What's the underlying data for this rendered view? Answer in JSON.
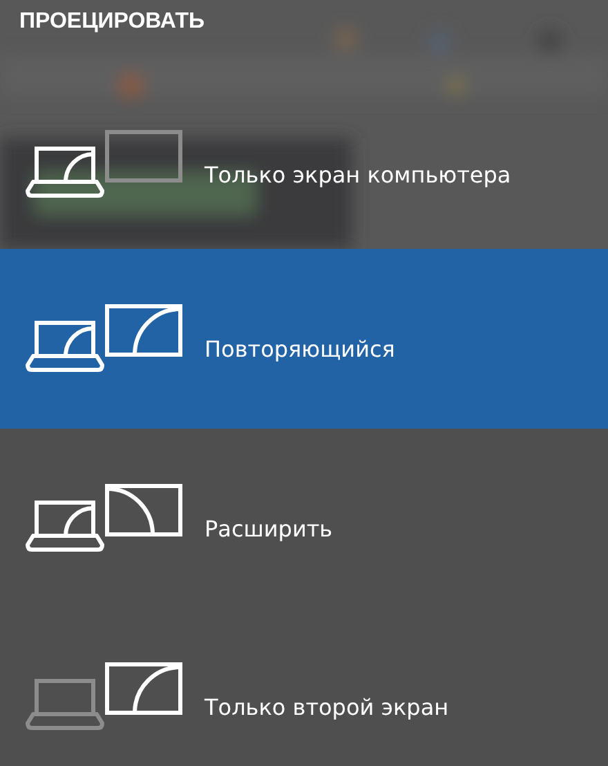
{
  "title": "ПРОЕЦИРОВАТЬ",
  "options": [
    {
      "kind": "pc_only",
      "label": "Только экран компьютера",
      "selected": false
    },
    {
      "kind": "duplicate",
      "label": "Повторяющийся",
      "selected": true
    },
    {
      "kind": "extend",
      "label": "Расширить",
      "selected": false
    },
    {
      "kind": "second_only",
      "label": "Только второй экран",
      "selected": false
    }
  ]
}
